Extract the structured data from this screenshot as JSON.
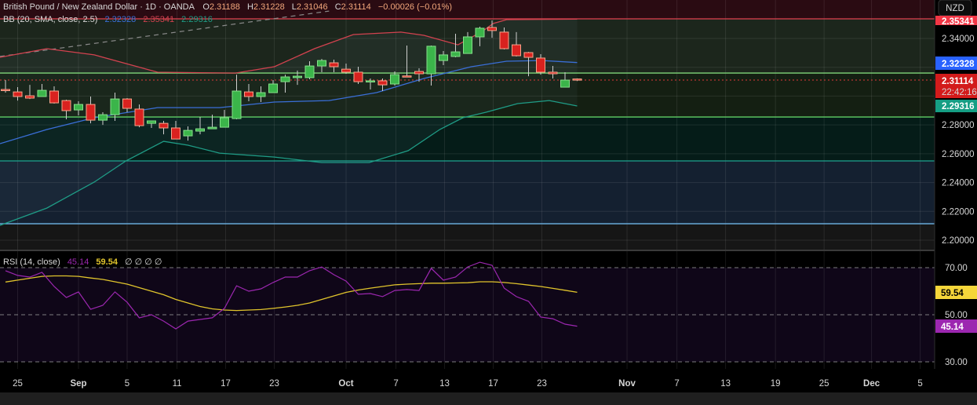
{
  "header": {
    "symbol": "British Pound / New Zealand Dollar · 1D · OANDA",
    "open_label": "O",
    "open": "2.31188",
    "high_label": "H",
    "high": "2.31228",
    "low_label": "L",
    "low": "2.31046",
    "close_label": "C",
    "close": "2.31114",
    "change": "−0.00026 (−0.01%)"
  },
  "bb_legend": {
    "label": "BB (20, SMA, close, 2.5)",
    "basis": "2.32328",
    "upper": "2.35341",
    "lower": "2.29316"
  },
  "rsi_legend": {
    "label": "RSI (14, close)",
    "rsi": "45.14",
    "ma": "59.54",
    "extras": "∅  ∅  ∅  ∅"
  },
  "price_axis": {
    "currency": "NZD",
    "ticks": [
      "2.34000",
      "2.28000",
      "2.26000",
      "2.24000",
      "2.22000",
      "2.20000"
    ],
    "tick_values": [
      2.34,
      2.28,
      2.26,
      2.24,
      2.22,
      2.2
    ],
    "bb_upper_badge": "2.35341",
    "bb_basis_badge": "2.32328",
    "last_price_badge": "2.31114",
    "countdown": "22:42:16",
    "bb_lower_badge": "2.29316"
  },
  "rsi_axis": {
    "ticks": [
      "70.00",
      "50.00",
      "30.00"
    ],
    "tick_values": [
      70,
      50,
      30
    ],
    "ma_badge": "59.54",
    "rsi_badge": "45.14"
  },
  "time_axis": {
    "labels": [
      {
        "text": "25",
        "bar": 1,
        "month": false
      },
      {
        "text": "Sep",
        "bar": 6,
        "month": true
      },
      {
        "text": "5",
        "bar": 10,
        "month": false
      },
      {
        "text": "11",
        "bar": 14.1,
        "month": false
      },
      {
        "text": "17",
        "bar": 18.1,
        "month": false
      },
      {
        "text": "23",
        "bar": 22.1,
        "month": false
      },
      {
        "text": "Oct",
        "bar": 28,
        "month": true
      },
      {
        "text": "7",
        "bar": 32.1,
        "month": false
      },
      {
        "text": "13",
        "bar": 36.1,
        "month": false
      },
      {
        "text": "17",
        "bar": 40.1,
        "month": false
      },
      {
        "text": "23",
        "bar": 44.1,
        "month": false
      },
      {
        "text": "Nov",
        "bar": 51.1,
        "month": true
      },
      {
        "text": "7",
        "bar": 55.2,
        "month": false
      },
      {
        "text": "13",
        "bar": 59.2,
        "month": false
      },
      {
        "text": "19",
        "bar": 63.3,
        "month": false
      },
      {
        "text": "25",
        "bar": 67.3,
        "month": false
      },
      {
        "text": "Dec",
        "bar": 71.2,
        "month": true
      },
      {
        "text": "5",
        "bar": 75.2,
        "month": false
      }
    ]
  },
  "colors": {
    "up": "#3bb54a",
    "up_border": "#86e08a",
    "down": "#d9221f",
    "down_border": "#f7a58c",
    "bb_upper": "#d2424f",
    "bb_basis": "#3a6fd8",
    "bb_lower": "#1f9c86",
    "rsi": "#9c27b0",
    "rsi_ma": "#e0c42c",
    "header_values": "#f3a87c"
  },
  "chart_data": {
    "type": "candlestick",
    "title": "British Pound / New Zealand Dollar · 1D · OANDA",
    "ohlc_order": [
      "open",
      "high",
      "low",
      "close"
    ],
    "candles": [
      [
        2.3046,
        2.3111,
        2.3024,
        2.3044
      ],
      [
        2.3029,
        2.3062,
        2.2969,
        2.2997
      ],
      [
        2.3002,
        2.3078,
        2.298,
        2.2986
      ],
      [
        2.2997,
        2.3084,
        2.2997,
        2.304
      ],
      [
        2.3035,
        2.3068,
        2.2948,
        2.2953
      ],
      [
        2.2969,
        2.2975,
        2.2839,
        2.2899
      ],
      [
        2.2904,
        2.2964,
        2.2866,
        2.2942
      ],
      [
        2.2942,
        2.2997,
        2.2811,
        2.2833
      ],
      [
        2.2833,
        2.2888,
        2.28,
        2.2871
      ],
      [
        2.2871,
        2.3024,
        2.2828,
        2.298
      ],
      [
        2.298,
        2.2986,
        2.2888,
        2.2915
      ],
      [
        2.291,
        2.2942,
        2.2784,
        2.2795
      ],
      [
        2.2811,
        2.2828,
        2.2779,
        2.2828
      ],
      [
        2.2811,
        2.2828,
        2.2735,
        2.2779
      ],
      [
        2.2779,
        2.2828,
        2.2702,
        2.2702
      ],
      [
        2.2724,
        2.279,
        2.2691,
        2.2762
      ],
      [
        2.2757,
        2.2855,
        2.2735,
        2.2773
      ],
      [
        2.2773,
        2.2871,
        2.2773,
        2.2784
      ],
      [
        2.2784,
        2.2904,
        2.2784,
        2.285
      ],
      [
        2.2844,
        2.3149,
        2.2839,
        2.3035
      ],
      [
        2.3029,
        2.3084,
        2.2964,
        2.2997
      ],
      [
        2.2997,
        2.3068,
        2.2959,
        2.3024
      ],
      [
        2.3024,
        2.3111,
        2.3024,
        2.3084
      ],
      [
        2.31,
        2.3149,
        2.3024,
        2.3133
      ],
      [
        2.3128,
        2.3177,
        2.3078,
        2.3138
      ],
      [
        2.3128,
        2.3242,
        2.3117,
        2.3209
      ],
      [
        2.3209,
        2.3258,
        2.3166,
        2.3247
      ],
      [
        2.3231,
        2.3253,
        2.3166,
        2.3204
      ],
      [
        2.3187,
        2.3226,
        2.3155,
        2.3166
      ],
      [
        2.3166,
        2.3204,
        2.3084,
        2.31
      ],
      [
        2.31,
        2.3122,
        2.3046,
        2.3106
      ],
      [
        2.3106,
        2.3122,
        2.3035,
        2.3078
      ],
      [
        2.3084,
        2.3171,
        2.3073,
        2.3149
      ],
      [
        2.314,
        2.3351,
        2.3133,
        2.3138
      ],
      [
        2.3171,
        2.3193,
        2.31,
        2.3155
      ],
      [
        2.3155,
        2.3351,
        2.3073,
        2.3346
      ],
      [
        2.3247,
        2.3313,
        2.3215,
        2.3286
      ],
      [
        2.3275,
        2.3433,
        2.3269,
        2.3307
      ],
      [
        2.3296,
        2.3444,
        2.3296,
        2.3411
      ],
      [
        2.3411,
        2.3482,
        2.3346,
        2.3471
      ],
      [
        2.3476,
        2.3525,
        2.3405,
        2.3455
      ],
      [
        2.3444,
        2.3476,
        2.3324,
        2.3329
      ],
      [
        2.3356,
        2.3444,
        2.3275,
        2.328
      ],
      [
        2.3302,
        2.3307,
        2.3138,
        2.3269
      ],
      [
        2.3264,
        2.3291,
        2.3149,
        2.3166
      ],
      [
        2.3166,
        2.3209,
        2.3122,
        2.3155
      ],
      [
        2.3062,
        2.3166,
        2.3062,
        2.3111
      ],
      [
        2.31188,
        2.31228,
        2.31046,
        2.31114
      ]
    ],
    "bollinger": {
      "upper": [
        [
          -0.45,
          2.3269
        ],
        [
          3.4,
          2.3329
        ],
        [
          7.3,
          2.3286
        ],
        [
          12.5,
          2.3166
        ],
        [
          18.9,
          2.316
        ],
        [
          22.1,
          2.3204
        ],
        [
          25.4,
          2.3329
        ],
        [
          28.6,
          2.3427
        ],
        [
          32.5,
          2.3444
        ],
        [
          34.4,
          2.3422
        ],
        [
          37.2,
          2.3356
        ],
        [
          39.2,
          2.3449
        ],
        [
          40.1,
          2.3504
        ],
        [
          41.2,
          2.3531
        ],
        [
          47,
          2.35341
        ]
      ],
      "basis": [
        [
          -0.45,
          2.267
        ],
        [
          3.4,
          2.2768
        ],
        [
          7.3,
          2.285
        ],
        [
          12.5,
          2.292
        ],
        [
          17.6,
          2.292
        ],
        [
          22.1,
          2.2959
        ],
        [
          26.6,
          2.2969
        ],
        [
          30.5,
          2.3024
        ],
        [
          34.4,
          2.3122
        ],
        [
          38.3,
          2.3204
        ],
        [
          41.2,
          2.3242
        ],
        [
          44.1,
          2.3247
        ],
        [
          47,
          2.32328
        ]
      ],
      "lower": [
        [
          -0.45,
          2.2103
        ],
        [
          3.4,
          2.2223
        ],
        [
          7.3,
          2.2403
        ],
        [
          9.9,
          2.255
        ],
        [
          13,
          2.2686
        ],
        [
          15,
          2.2659
        ],
        [
          17.6,
          2.2604
        ],
        [
          22.1,
          2.2577
        ],
        [
          26,
          2.2539
        ],
        [
          29.9,
          2.2539
        ],
        [
          33.1,
          2.2621
        ],
        [
          35.7,
          2.2768
        ],
        [
          37.6,
          2.285
        ],
        [
          39.5,
          2.2888
        ],
        [
          42.1,
          2.2948
        ],
        [
          44.7,
          2.2969
        ],
        [
          47,
          2.29316
        ]
      ]
    },
    "levels": {
      "red": 2.3536,
      "green_upper": 2.316,
      "green_lower": 2.2855,
      "teal": 2.255,
      "blue": 2.2114
    },
    "trendline": [
      [
        -0.45,
        2.3275
      ],
      [
        26.6,
        2.359
      ]
    ],
    "last_price": 2.31114,
    "price_range": [
      2.1965,
      2.3667
    ],
    "rsi": [
      68.7,
      66.7,
      66,
      68,
      62,
      57.3,
      59.7,
      52.3,
      54,
      59.7,
      55.3,
      48.7,
      50,
      47.3,
      44,
      47.3,
      48,
      48.7,
      52.7,
      62.3,
      60,
      61,
      63.7,
      66,
      66,
      68.7,
      70.3,
      67,
      64.3,
      58.7,
      59,
      57.7,
      60.3,
      60.7,
      60.3,
      69.7,
      64.7,
      66,
      70.3,
      72.3,
      71,
      61.3,
      57.7,
      55.7,
      49,
      48.3,
      46,
      45.14
    ],
    "rsi_ma": [
      63.9,
      64.7,
      65.5,
      66.3,
      66.5,
      66.5,
      66.3,
      65.6,
      65,
      64,
      63,
      61.5,
      60,
      58.5,
      56.5,
      55,
      53.5,
      52.5,
      52,
      51.8,
      52,
      52.2,
      52.7,
      53.3,
      54,
      55,
      56.5,
      58,
      59.5,
      60.5,
      61.3,
      62,
      62.7,
      63,
      63.2,
      63.4,
      63.4,
      63.5,
      63.6,
      64,
      64,
      63.7,
      63.2,
      62.6,
      62,
      61.2,
      60.4,
      59.54
    ],
    "rsi_levels": [
      70,
      50,
      30
    ]
  }
}
